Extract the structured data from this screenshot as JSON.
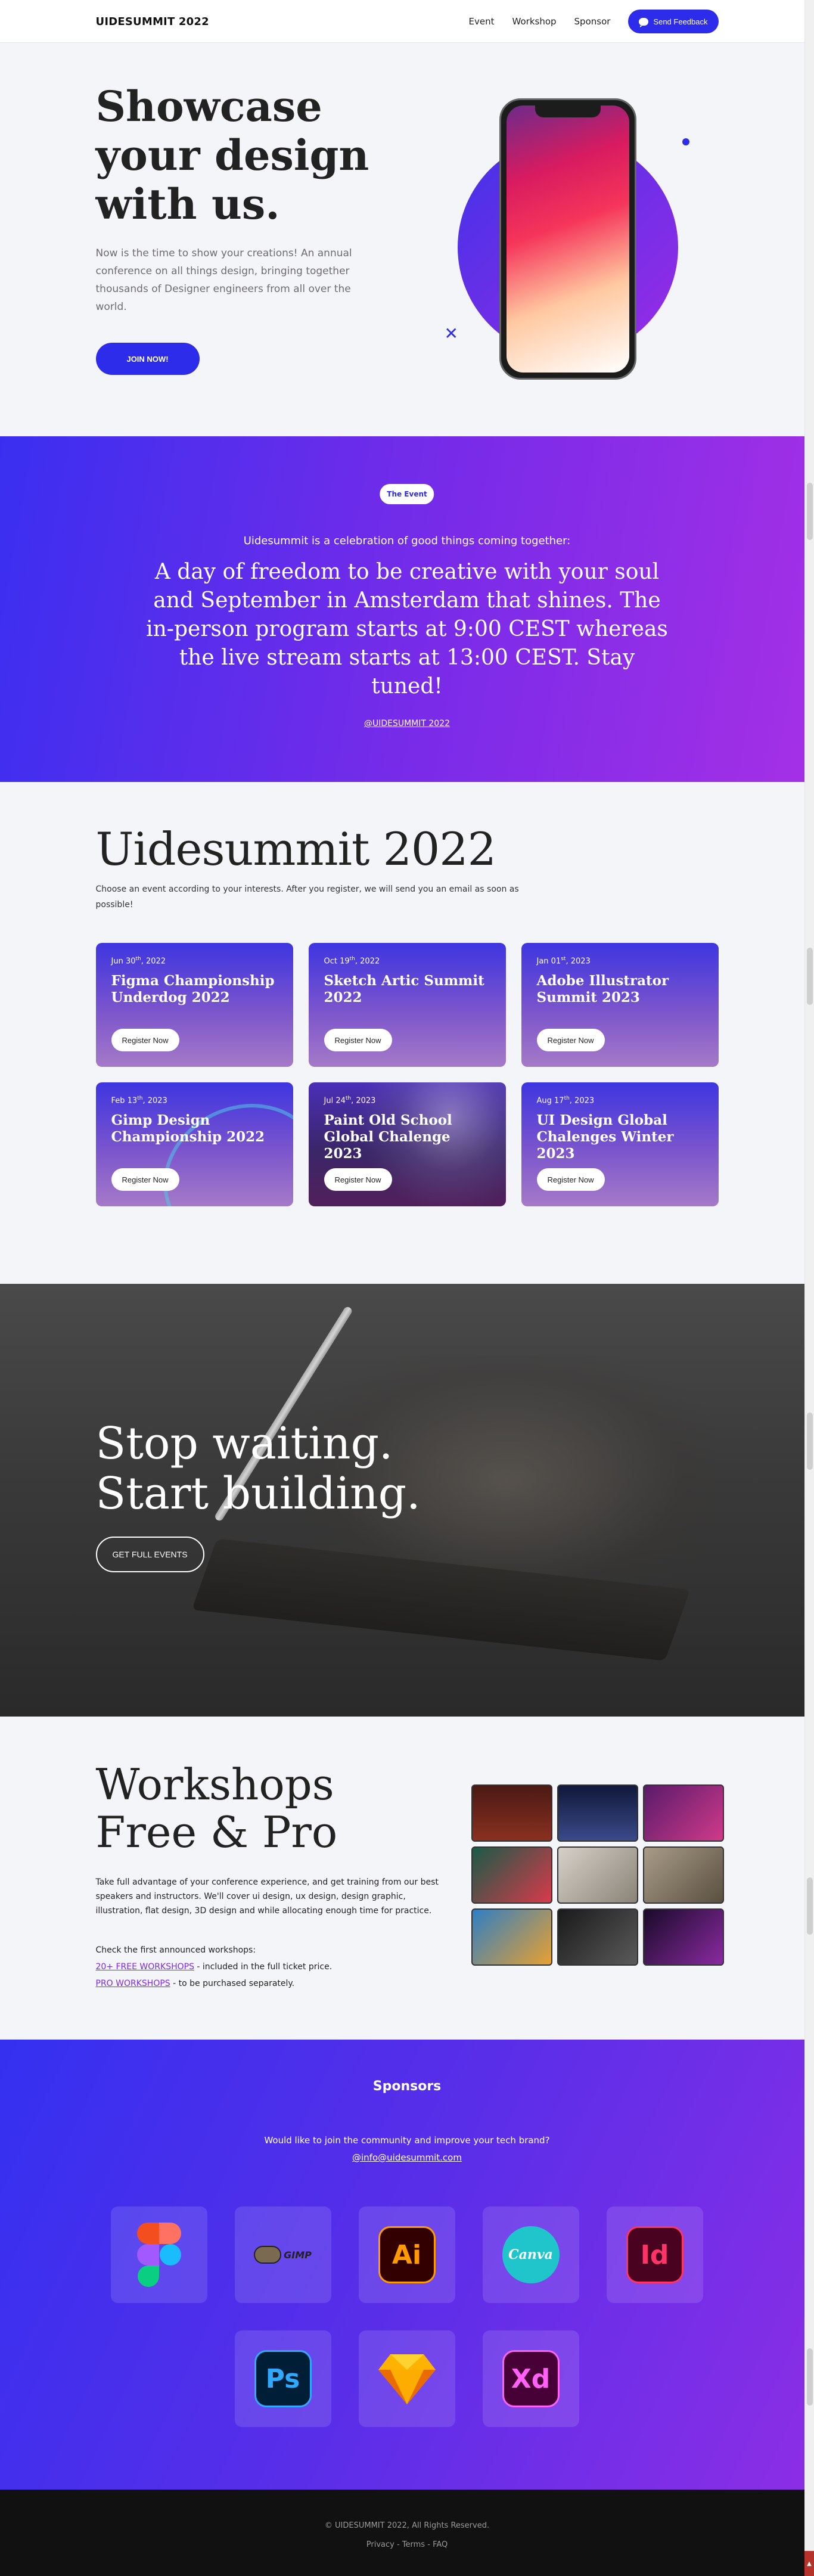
{
  "header": {
    "logo": "UIDESUMMIT 2022",
    "nav": [
      "Event",
      "Workshop",
      "Sponsor"
    ],
    "feedback_button": "Send Feedback"
  },
  "hero": {
    "title": "Showcase your design with us.",
    "description": "Now is the time to show your creations! An annual conference on all things design, bringing together thousands of Designer engineers from all over the world.",
    "cta": "JOIN NOW!",
    "accent": "#2d2cea"
  },
  "event": {
    "pill": "The Event",
    "lead": "Uidesummit is a celebration of good things coming together:",
    "headline": "A day of freedom to be creative with your soul and September in Amsterdam that shines. The in-person program starts at 9:00 CEST whereas the live stream starts at 13:00 CEST. Stay tuned!",
    "handle": "@UIDESUMMIT 2022"
  },
  "summit": {
    "title": "Uidesummit 2022",
    "description": "Choose an event according to your interests. After you register, we will send you an email as soon as possible!",
    "register_label": "Register Now",
    "cards": [
      {
        "date_pre": "Jun 30",
        "date_sup": "th",
        "date_post": ", 2022",
        "title": "Figma Championship Underdog 2022"
      },
      {
        "date_pre": "Oct 19",
        "date_sup": "th",
        "date_post": ", 2022",
        "title": "Sketch Artic Summit 2022"
      },
      {
        "date_pre": "Jan 01",
        "date_sup": "st",
        "date_post": ", 2023",
        "title": "Adobe Illustrator Summit 2023"
      },
      {
        "date_pre": "Feb 13",
        "date_sup": "th",
        "date_post": ", 2023",
        "title": "Gimp Design Championship 2022"
      },
      {
        "date_pre": "Jul 24",
        "date_sup": "th",
        "date_post": ", 2023",
        "title": "Paint Old School Global Chalenge 2023"
      },
      {
        "date_pre": "Aug 17",
        "date_sup": "th",
        "date_post": ", 2023",
        "title": "UI Design Global Chalenges Winter 2023"
      }
    ]
  },
  "stop": {
    "line1": "Stop waiting.",
    "line2": "Start building.",
    "cta": "GET FULL EVENTS"
  },
  "workshops": {
    "title_line1": "Workshops",
    "title_line2": "Free & Pro",
    "text": "Take full advantage of your conference experience, and get training from our best speakers and instructors. We'll cover ui design, ux design, design graphic, illustration, flat design, 3D design and while allocating enough time for practice.",
    "check": "Check the first announced workshops:",
    "free_link": "20+ FREE WORKSHOPS",
    "free_note": " - included in the full ticket price.",
    "pro_link": "PRO WORKSHOPS",
    "pro_note": " - to be purchased separately.",
    "tiles": [
      "#6e2418",
      "#1c2848",
      "#8a2a6a",
      "#1f6e58",
      "#b7b0a6",
      "#8c8070",
      "#2f7ec4",
      "#2b2b2b",
      "#3a1a4a"
    ]
  },
  "sponsors": {
    "title": "Sponsors",
    "ask": "Would like to join the community and improve your tech brand?",
    "email": "@info@uidesummit.com",
    "logos": [
      {
        "icon": "figma-icon",
        "label": ""
      },
      {
        "icon": "gimp-icon",
        "label": "GIMP"
      },
      {
        "icon": "illustrator-icon",
        "label": "Ai"
      },
      {
        "icon": "canva-icon",
        "label": "Canva"
      },
      {
        "icon": "indesign-icon",
        "label": "Id"
      },
      {
        "icon": "photoshop-icon",
        "label": "Ps"
      },
      {
        "icon": "sketch-icon",
        "label": ""
      },
      {
        "icon": "xd-icon",
        "label": "Xd"
      }
    ]
  },
  "footer": {
    "copyright": "© UIDESUMMIT 2022, All Rights Reserved.",
    "links": [
      "Privacy",
      "Terms",
      "FAQ"
    ]
  }
}
